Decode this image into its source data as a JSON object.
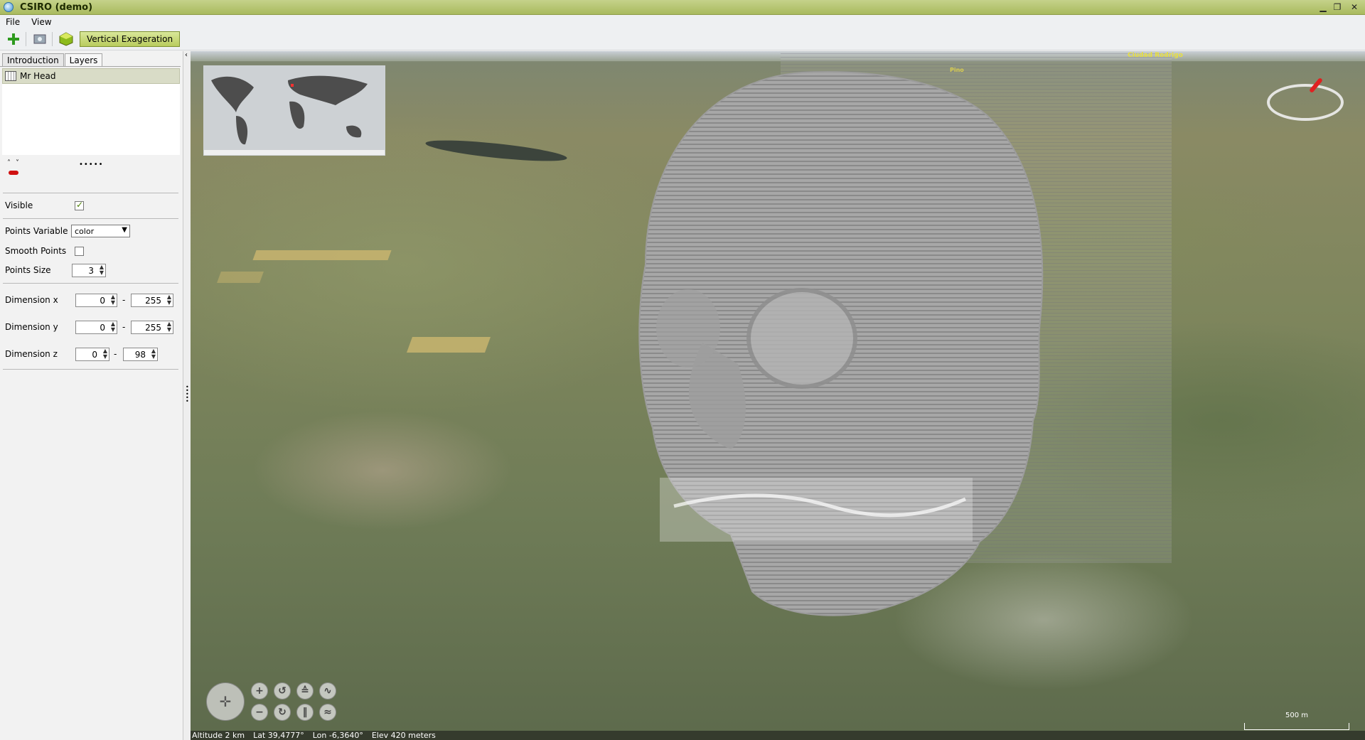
{
  "window": {
    "title": "CSIRO (demo)"
  },
  "menu": {
    "file": "File",
    "view": "View"
  },
  "toolbar": {
    "vertical_exageration": "Vertical Exageration"
  },
  "tabs": {
    "introduction": "Introduction",
    "layers": "Layers"
  },
  "layers": [
    {
      "name": "Mr Head"
    }
  ],
  "properties": {
    "visible_label": "Visible",
    "visible_checked": true,
    "points_variable_label": "Points Variable",
    "points_variable_value": "color",
    "smooth_points_label": "Smooth Points",
    "smooth_points_checked": false,
    "points_size_label": "Points Size",
    "points_size_value": "3",
    "dimension_x_label": "Dimension x",
    "dimension_x_min": "0",
    "dimension_x_max": "255",
    "dimension_y_label": "Dimension y",
    "dimension_y_min": "0",
    "dimension_y_max": "255",
    "dimension_z_label": "Dimension z",
    "dimension_z_min": "0",
    "dimension_z_max": "98",
    "range_separator": "-"
  },
  "map": {
    "place_label": "Ciudad Rodrigo",
    "small_label": "Pino",
    "scale_label": "500 m"
  },
  "status": {
    "altitude": "Altitude 2 km",
    "lat": "Lat 39,4777°",
    "lon": "Lon -6,3640°",
    "elev": "Elev 420 meters"
  },
  "colors": {
    "title_bar": "#b4c46c",
    "accent_button": "#c8d97a",
    "layer_selected": "#d9dcc7"
  }
}
